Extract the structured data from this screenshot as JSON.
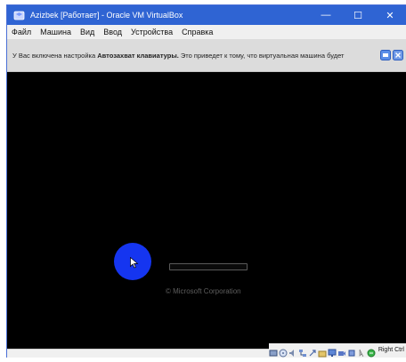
{
  "window": {
    "title": "Azizbek [Работает] - Oracle VM VirtualBox",
    "minimize": "—",
    "maximize": "☐",
    "close": "✕"
  },
  "menu": [
    "Файл",
    "Машина",
    "Вид",
    "Ввод",
    "Устройства",
    "Справка"
  ],
  "notice": {
    "prefix": "У Вас включена настройка ",
    "bold": "Автозахват клавиатуры.",
    "suffix": " Это приведет к тому, что виртуальная машина будет"
  },
  "screen": {
    "copyright": "© Microsoft Corporation"
  },
  "status": {
    "host_key": "Right Ctrl"
  },
  "colors": {
    "titlebar": "#2f64d3",
    "cursor_highlight": "#1535f0"
  }
}
